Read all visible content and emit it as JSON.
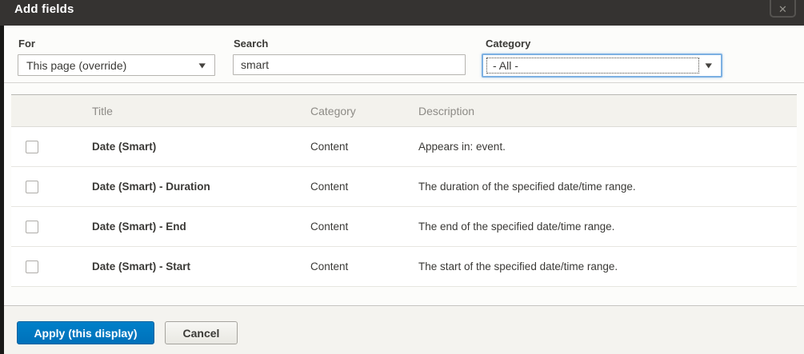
{
  "modal": {
    "title": "Add fields"
  },
  "icons": {
    "close": "✕",
    "chevron_down": "▼"
  },
  "filters": {
    "for": {
      "label": "For",
      "value": "This page (override)"
    },
    "search": {
      "label": "Search",
      "value": "smart",
      "placeholder": ""
    },
    "category": {
      "label": "Category",
      "value": "- All -"
    }
  },
  "table": {
    "headers": {
      "checkbox": "",
      "title": "Title",
      "category": "Category",
      "description": "Description"
    },
    "rows": [
      {
        "checked": false,
        "title": "Date (Smart)",
        "category": "Content",
        "description": "Appears in: event."
      },
      {
        "checked": false,
        "title": "Date (Smart) - Duration",
        "category": "Content",
        "description": "The duration of the specified date/time range."
      },
      {
        "checked": false,
        "title": "Date (Smart) - End",
        "category": "Content",
        "description": "The end of the specified date/time range."
      },
      {
        "checked": false,
        "title": "Date (Smart) - Start",
        "category": "Content",
        "description": "The start of the specified date/time range."
      }
    ]
  },
  "footer": {
    "apply_label": "Apply (this display)",
    "cancel_label": "Cancel"
  },
  "colors": {
    "header_bg": "#353331",
    "accent_blue": "#0074bd",
    "focus_blue": "#7cb0e2",
    "footer_bg": "#f4f3ef",
    "table_header_bg": "#f3f2ed",
    "table_header_text": "#8d8b86",
    "text": "#3a3936"
  }
}
